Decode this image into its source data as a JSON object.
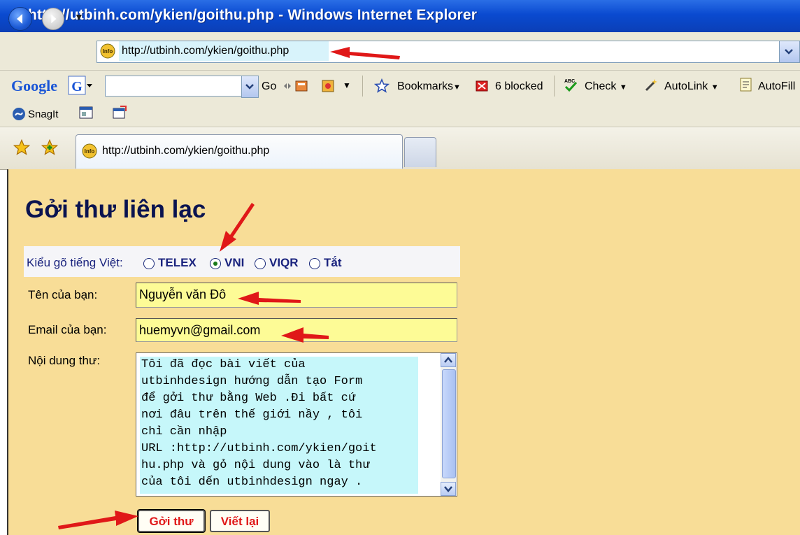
{
  "window": {
    "title": "http://utbinh.com/ykien/goithu.php - Windows Internet Explorer",
    "icon": "ie-logo-icon"
  },
  "address_bar": {
    "url": "http://utbinh.com/ykien/goithu.php",
    "site_icon": "favicon-icon"
  },
  "google_toolbar": {
    "logo": "Google",
    "go_label": "Go",
    "bookmarks_label": "Bookmarks",
    "blocked_label": "6 blocked",
    "check_label": "Check",
    "autolink_label": "AutoLink",
    "autofill_label": "AutoFill",
    "snagit_label": "SnagIt"
  },
  "tab": {
    "label": "http://utbinh.com/ykien/goithu.php"
  },
  "form": {
    "title": "Gởi thư liên lạc",
    "ime_label": "Kiểu gõ tiếng Việt:",
    "ime_options": [
      "TELEX",
      "VNI",
      "VIQR",
      "Tắt"
    ],
    "ime_selected": "VNI",
    "name_label": "Tên của bạn:",
    "name_value": "Nguyễn văn Đô",
    "email_label": "Email của bạn:",
    "email_value": "huemyvn@gmail.com",
    "message_label": "Nội dung thư:",
    "message_lines": [
      "Tôi đã đọc bài viết của",
      "utbinhdesign hướng dẫn tạo Form",
      "để gởi thư bằng Web .Đi bất cứ",
      "nơi đâu trên thế giới nầy , tôi",
      "chỉ cần nhập",
      "URL :http://utbinh.com/ykien/goit",
      "hu.php và gỏ nội dung vào là thư",
      "của tôi dến utbinhdesign ngay ."
    ],
    "send_button": "Gởi thư",
    "reset_button": "Viết lại"
  },
  "colors": {
    "page_bg": "#f8dd97",
    "input_bg": "#fdfb96",
    "textarea_bg": "#c6f7fa",
    "arrow": "#e01818",
    "title": "#0a1350"
  }
}
